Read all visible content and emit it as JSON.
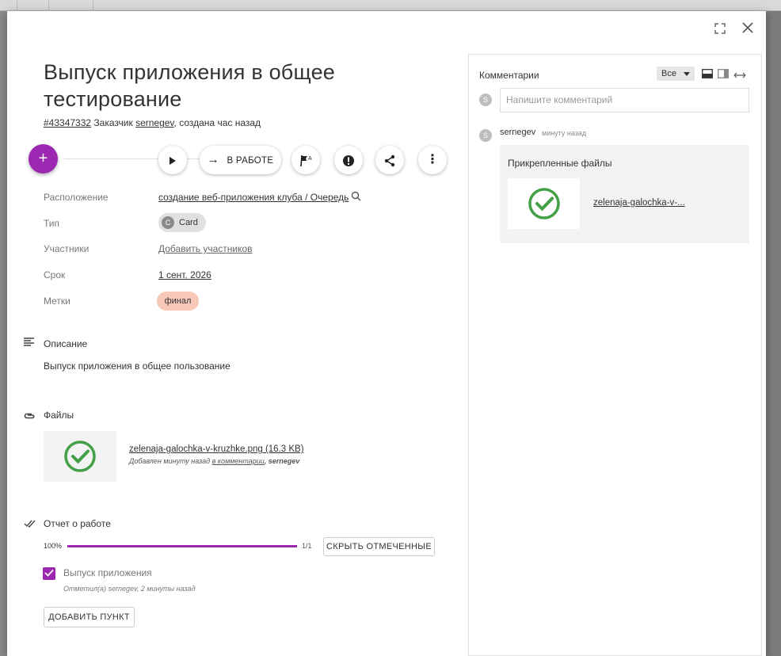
{
  "window": {
    "fullscreen_icon": "fullscreen-icon",
    "close_icon": "close-icon"
  },
  "task": {
    "title": "Выпуск приложения в общее тестирование",
    "id": "#43347332",
    "customer_label": "Заказчик",
    "customer": "sernegev",
    "created": ", создана час назад"
  },
  "toolbar": {
    "add": "+",
    "play": "▶",
    "status_label": "В РАБОТЕ",
    "status_arrow": "→",
    "more": "⋮"
  },
  "fields": {
    "location_label": "Расположение",
    "location_value": "создание веб-приложения клуба / Очередь",
    "type_label": "Тип",
    "type_value": "Card",
    "type_letter": "C",
    "members_label": "Участники",
    "members_value": "Добавить участников",
    "due_label": "Срок",
    "due_value": "1 сент. 2026",
    "tags_label": "Метки",
    "tag_value": "финал"
  },
  "description": {
    "heading": "Описание",
    "text": "Выпуск приложения в общее пользование"
  },
  "files": {
    "heading": "Файлы",
    "file_name": "zelenaja-galochka-v-kruzhke.png (16.3 KB)",
    "added_prefix": "Добавлен минуту назад ",
    "added_link": "в комментарии",
    "added_by": ", sernegev"
  },
  "report": {
    "heading": "Отчет о работе",
    "percent": "100%",
    "progress": 1.0,
    "count": "1/1",
    "hide_button": "СКРЫТЬ ОТМЕЧЕННЫЕ",
    "item_label": "Выпуск приложения",
    "item_checked": true,
    "item_meta": "Отметил(а) sernegev, 2 минуты назад",
    "add_button": "ДОБАВИТЬ ПУНКТ"
  },
  "comments": {
    "heading": "Комментарии",
    "filter_value": "Все",
    "input_placeholder": "Напишите комментарий",
    "avatar_letter": "S",
    "author": "sernegev",
    "time": "минуту назад",
    "attach_heading": "Прикрепленные файлы",
    "attach_name": "zelenaja-galochka-v-..."
  },
  "colors": {
    "accent": "#9c27b0",
    "tag": "#f7c7b8",
    "check_green": "#43a047"
  }
}
